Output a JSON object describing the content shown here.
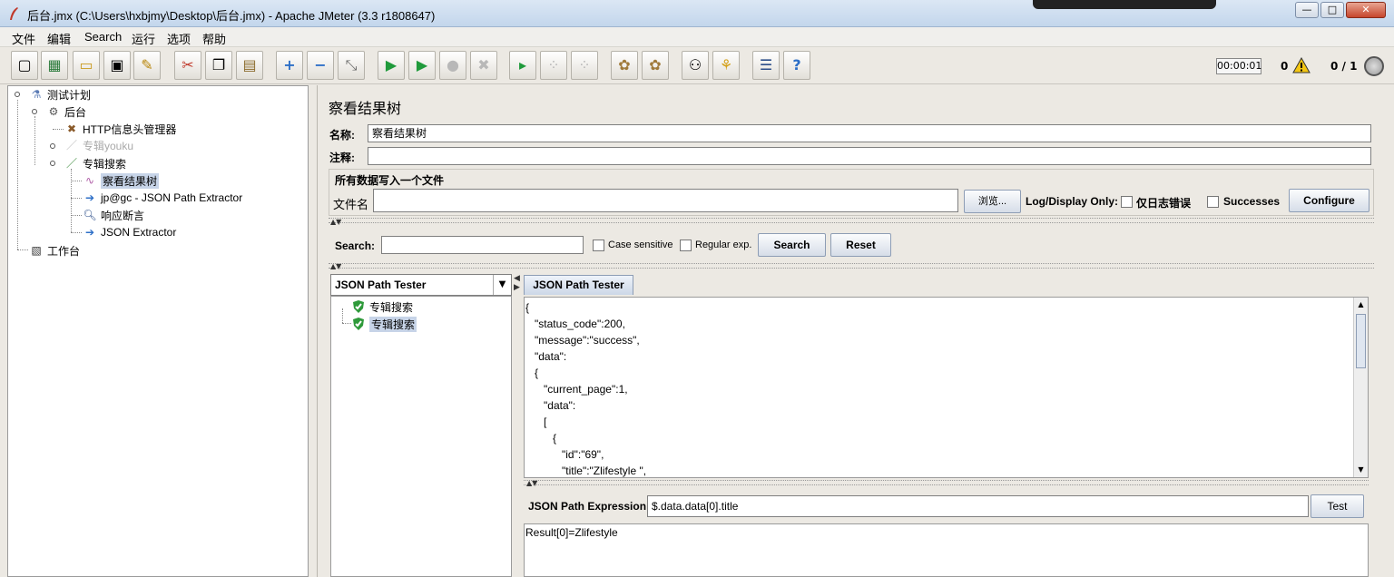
{
  "window": {
    "title": "后台.jmx (C:\\Users\\hxbjmy\\Desktop\\后台.jmx) - Apache JMeter (3.3 r1808647)",
    "minimize": "—",
    "maximize": "□",
    "close": "✕"
  },
  "menu": [
    "文件",
    "编辑",
    "Search",
    "运行",
    "选项",
    "帮助"
  ],
  "toolbar": {
    "timer": "00:00:01",
    "error_count": "0",
    "threads": "0 / 1"
  },
  "tree": {
    "test_plan": "测试计划",
    "thread_group": "后台",
    "header_manager": "HTTP信息头管理器",
    "sampler_disabled": "专辑youku",
    "sampler_search": "专辑搜索",
    "view_results_tree": "察看结果树",
    "json_extractor_1": "jp@gc - JSON Path Extractor",
    "response_assertion": "响应断言",
    "json_extractor_2": "JSON Extractor",
    "workbench": "工作台"
  },
  "panel": {
    "title": "察看结果树",
    "name_label": "名称:",
    "name_value": "察看结果树",
    "comment_label": "注释:",
    "comment_value": "",
    "file_group_title": "所有数据写入一个文件",
    "filename_label": "文件名",
    "filename_value": "",
    "browse_button": "浏览...",
    "log_display_label": "Log/Display Only:",
    "errors_only_label": "仅日志错误",
    "successes_label": "Successes",
    "configure_button": "Configure"
  },
  "search": {
    "label": "Search:",
    "value": "",
    "case_sensitive": "Case sensitive",
    "regular_exp": "Regular exp.",
    "search_button": "Search",
    "reset_button": "Reset"
  },
  "results": {
    "renderer": "JSON Path Tester",
    "samples": [
      "专辑搜索",
      "专辑搜索"
    ],
    "tab_label": "JSON Path Tester",
    "json_lines": [
      "{",
      "   \"status_code\":200,",
      "   \"message\":\"success\",",
      "   \"data\":",
      "   {",
      "      \"current_page\":1,",
      "      \"data\":",
      "      [",
      "         {",
      "            \"id\":\"69\",",
      "            \"title\":\"Zlifestyle \","
    ],
    "expression_label": "JSON Path Expression",
    "expression_value": "$.data.data[0].title",
    "test_button": "Test",
    "result_text": "Result[0]=Zlifestyle"
  },
  "colors": {
    "selection": "#c7d4e8",
    "success_icon": "#2e9a3a",
    "window_bg": "#ece9e3"
  }
}
